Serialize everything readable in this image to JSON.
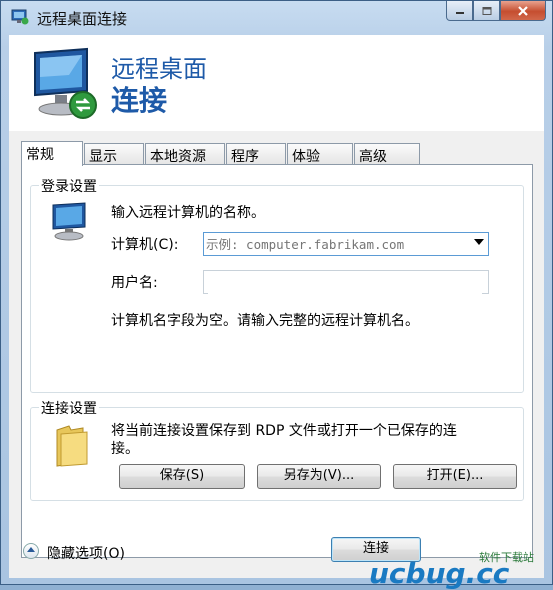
{
  "window": {
    "title": "远程桌面连接",
    "controls": [
      "minimize-icon",
      "maximize-icon",
      "close-icon"
    ]
  },
  "header": {
    "line1": "远程桌面",
    "line2": "连接"
  },
  "tabs": [
    {
      "label": "常规",
      "active": true
    },
    {
      "label": "显示",
      "active": false
    },
    {
      "label": "本地资源",
      "active": false
    },
    {
      "label": "程序",
      "active": false
    },
    {
      "label": "体验",
      "active": false
    },
    {
      "label": "高级",
      "active": false
    }
  ],
  "login": {
    "group_title": "登录设置",
    "instruction": "输入远程计算机的名称。",
    "computer_label": "计算机(C):",
    "computer_placeholder": "示例: computer.fabrikam.com",
    "computer_value": "",
    "username_label": "用户名:",
    "username_value": "",
    "warning": "计算机名字段为空。请输入完整的远程计算机名。"
  },
  "connection": {
    "group_title": "连接设置",
    "description_line1": "将当前连接设置保存到 RDP 文件或打开一个已保存的连",
    "description_line2": "接。",
    "save_button": "保存(S)",
    "save_as_button": "另存为(V)...",
    "open_button": "打开(E)..."
  },
  "footer": {
    "hide_options": "隐藏选项(O)",
    "connect_button": "连接"
  },
  "watermark": {
    "brand_cn": "软件下载站",
    "logo_text": "ucbug",
    "logo_suffix": ".cc"
  },
  "colors": {
    "accent": "#1e5aa8",
    "titlebar": "#b8cfe8",
    "close_button": "#c54e30"
  }
}
